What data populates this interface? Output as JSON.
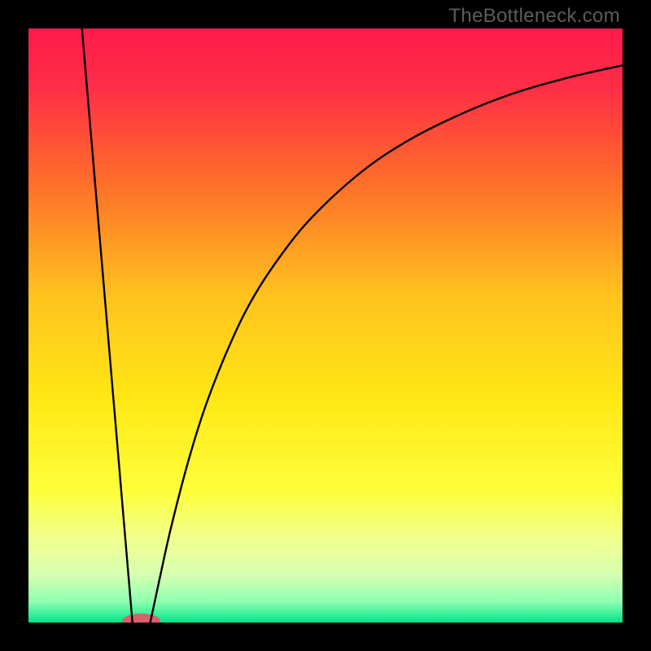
{
  "watermark": "TheBottleneck.com",
  "colors": {
    "frame": "#000000",
    "marker": "#d9606d",
    "curve": "#000000",
    "gradient_stops": [
      {
        "offset": 0.0,
        "color": "#ff1a4b"
      },
      {
        "offset": 0.1,
        "color": "#ff2e46"
      },
      {
        "offset": 0.25,
        "color": "#ff6a2b"
      },
      {
        "offset": 0.45,
        "color": "#ffc21e"
      },
      {
        "offset": 0.62,
        "color": "#ffe714"
      },
      {
        "offset": 0.78,
        "color": "#fdff3a"
      },
      {
        "offset": 0.86,
        "color": "#f0ff8f"
      },
      {
        "offset": 0.92,
        "color": "#d6ffb2"
      },
      {
        "offset": 0.965,
        "color": "#8dffb0"
      },
      {
        "offset": 1.0,
        "color": "#00e58a"
      }
    ]
  },
  "chart_data": {
    "type": "line",
    "title": "",
    "xlabel": "",
    "ylabel": "",
    "xlim": [
      0,
      100
    ],
    "ylim": [
      0,
      100
    ],
    "series": [
      {
        "name": "left-branch",
        "x": [
          9,
          17.5
        ],
        "y": [
          100,
          0
        ]
      },
      {
        "name": "right-branch",
        "x": [
          20.5,
          22,
          24,
          27,
          30,
          34,
          38,
          43,
          48,
          55,
          62,
          70,
          80,
          90,
          100
        ],
        "y": [
          0,
          7,
          16,
          27.5,
          37,
          47,
          55,
          62.5,
          68.5,
          75,
          80,
          84.3,
          88.5,
          91.5,
          93.8
        ]
      }
    ],
    "marker": {
      "cx": 19,
      "cy": 0.3,
      "rx": 3.2,
      "ry": 1.2
    },
    "annotations": []
  }
}
